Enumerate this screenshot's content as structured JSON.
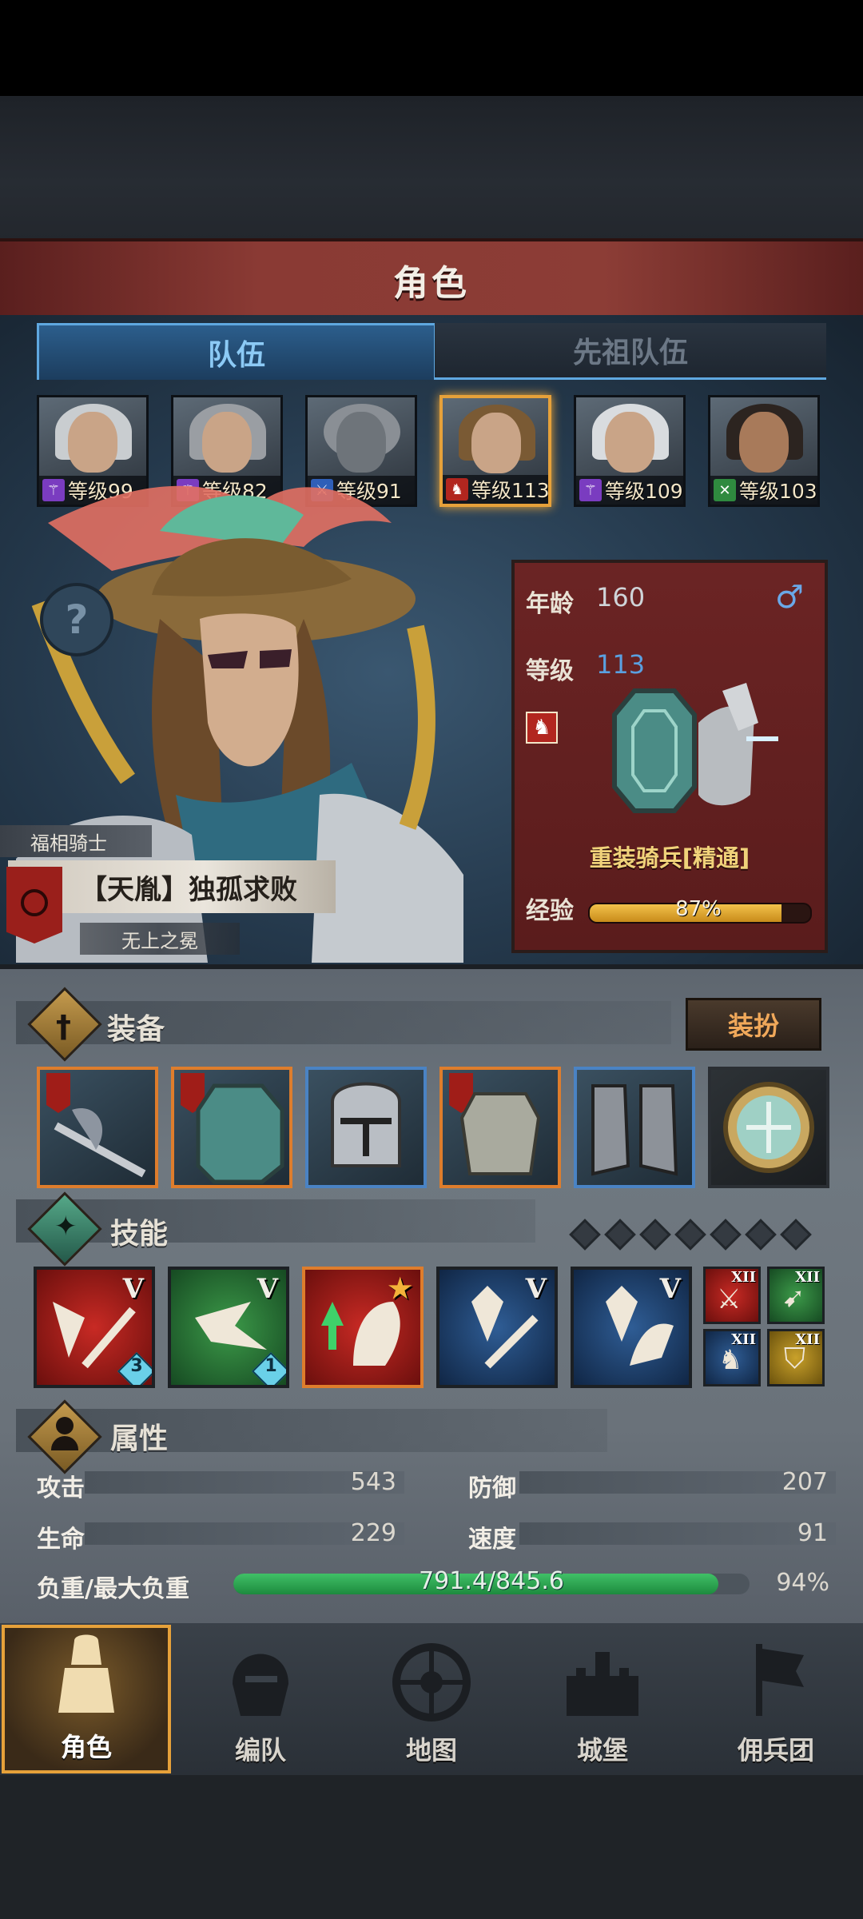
{
  "screen_title": "角色",
  "tabs": [
    {
      "label": "队伍",
      "active": true
    },
    {
      "label": "先祖队伍",
      "active": false
    }
  ],
  "party": [
    {
      "level_text": "等级99",
      "class_icon": "staff-icon",
      "class_color": "#7a3cc0"
    },
    {
      "level_text": "等级82",
      "class_icon": "staff-icon",
      "class_color": "#7a3cc0"
    },
    {
      "level_text": "等级91",
      "class_icon": "sword-icon",
      "class_color": "#2f5fb8"
    },
    {
      "level_text": "等级113",
      "class_icon": "horse-icon",
      "class_color": "#b2261f",
      "selected": true
    },
    {
      "level_text": "等级109",
      "class_icon": "staff-icon",
      "class_color": "#7a3cc0"
    },
    {
      "level_text": "等级103",
      "class_icon": "crossed-swords-icon",
      "class_color": "#2f8a3f"
    }
  ],
  "hero": {
    "class_tag": "福相骑士",
    "name": "【天胤】独孤求败",
    "sub_title": "无上之冕"
  },
  "info": {
    "age_label": "年龄",
    "age_value": "160",
    "gender_icon": "male-icon",
    "level_label": "等级",
    "level_value": "113",
    "unit_type": "重装骑兵[精通]",
    "exp_label": "经验",
    "exp_text": "87%",
    "exp_percent": 87
  },
  "equipment": {
    "title": "装备",
    "dress_button": "装扮",
    "slots": [
      {
        "item": "halberd",
        "rarity": "orange"
      },
      {
        "item": "shield",
        "rarity": "orange"
      },
      {
        "item": "helmet",
        "rarity": "blue"
      },
      {
        "item": "armor",
        "rarity": "orange"
      },
      {
        "item": "greaves",
        "rarity": "blue"
      },
      {
        "item": "medallion",
        "rarity": "none"
      }
    ]
  },
  "skills": {
    "title": "技能",
    "big": [
      {
        "rank": "V",
        "color": "red",
        "badge": "3"
      },
      {
        "rank": "V",
        "color": "green",
        "badge": "1"
      },
      {
        "rank": "★",
        "color": "red"
      },
      {
        "rank": "V",
        "color": "blue"
      },
      {
        "rank": "V",
        "color": "blue"
      }
    ],
    "small": [
      {
        "rank": "XII",
        "color": "red"
      },
      {
        "rank": "XII",
        "color": "green"
      },
      {
        "rank": "XII",
        "color": "blue"
      },
      {
        "rank": "XII",
        "color": "gold"
      }
    ]
  },
  "attributes": {
    "title": "属性",
    "attack_label": "攻击",
    "attack_value": "543",
    "defense_label": "防御",
    "defense_value": "207",
    "hp_label": "生命",
    "hp_value": "229",
    "speed_label": "速度",
    "speed_value": "91",
    "load_label": "负重/最大负重",
    "load_text": "791.4/845.6",
    "load_percent_text": "94%",
    "load_percent": 94
  },
  "nav": [
    {
      "label": "角色",
      "icon": "knight-icon",
      "active": true
    },
    {
      "label": "编队",
      "icon": "helmet-icon"
    },
    {
      "label": "地图",
      "icon": "compass-icon"
    },
    {
      "label": "城堡",
      "icon": "castle-icon"
    },
    {
      "label": "佣兵团",
      "icon": "banner-icon"
    }
  ],
  "colors": {
    "accent_gold": "#e6a13a",
    "title_red": "#8a3a34",
    "tab_blue": "#5fa8e0"
  }
}
